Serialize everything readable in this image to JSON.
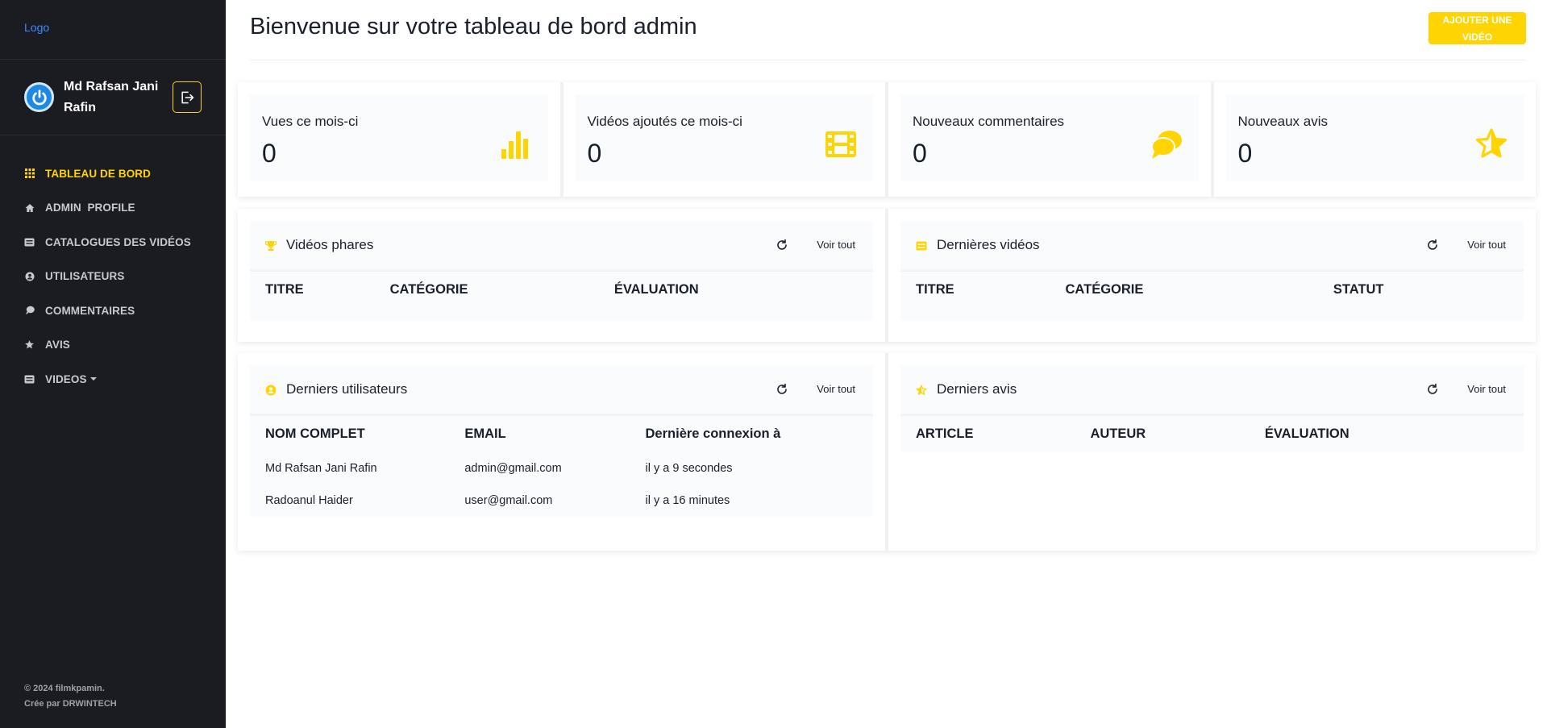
{
  "sidebar": {
    "logo": "Logo",
    "user_name": "Md Rafsan Jani Rafin",
    "nav": [
      {
        "label": "TABLEAU DE BORD",
        "icon": "grid-icon",
        "active": true
      },
      {
        "label": "ADMIN  PROFILE",
        "icon": "home-icon"
      },
      {
        "label": "CATALOGUES DES VIDÉOS",
        "icon": "video-icon"
      },
      {
        "label": "UTILISATEURS",
        "icon": "users-icon"
      },
      {
        "label": "COMMENTAIRES",
        "icon": "comments-icon"
      },
      {
        "label": "AVIS",
        "icon": "star-icon"
      },
      {
        "label": "VIDEOS",
        "icon": "video-icon",
        "dropdown": true
      }
    ],
    "footer_line1": "© 2024 filmkpamin.",
    "footer_line2": "Crée par DRWINTECH"
  },
  "header": {
    "title": "Bienvenue sur votre tableau de bord admin",
    "add_button": "AJOUTER UNE VIDÉO"
  },
  "stats": [
    {
      "label": "Vues ce mois-ci",
      "value": "0",
      "icon": "bar-chart-icon"
    },
    {
      "label": "Vidéos ajoutés ce mois-ci",
      "value": "0",
      "icon": "film-icon"
    },
    {
      "label": "Nouveaux commentaires",
      "value": "0",
      "icon": "comments-icon"
    },
    {
      "label": "Nouveaux avis",
      "value": "0",
      "icon": "star-icon"
    }
  ],
  "panels": {
    "top_videos": {
      "title": "Vidéos phares",
      "icon": "trophy-icon",
      "see_all": "Voir tout",
      "columns": [
        "TITRE",
        "CATÉGORIE",
        "ÉVALUATION"
      ]
    },
    "latest_videos": {
      "title": "Dernières vidéos",
      "icon": "video-icon",
      "see_all": "Voir tout",
      "columns": [
        "TITRE",
        "CATÉGORIE",
        "STATUT"
      ]
    },
    "latest_users": {
      "title": "Derniers utilisateurs",
      "icon": "users-icon",
      "see_all": "Voir tout",
      "columns": [
        "NOM COMPLET",
        "EMAIL",
        "Dernière connexion à"
      ],
      "rows": [
        [
          "Md Rafsan Jani Rafin",
          "admin@gmail.com",
          "il y a 9 secondes"
        ],
        [
          "Radoanul Haider",
          "user@gmail.com",
          "il y a 16 minutes"
        ]
      ]
    },
    "latest_reviews": {
      "title": "Derniers avis",
      "icon": "star-half-icon",
      "see_all": "Voir tout",
      "columns": [
        "ARTICLE",
        "AUTEUR",
        "ÉVALUATION"
      ]
    }
  },
  "colors": {
    "accent": "#ffd400",
    "sidebar_bg": "#1b1b22",
    "link": "#3d8bfd"
  }
}
